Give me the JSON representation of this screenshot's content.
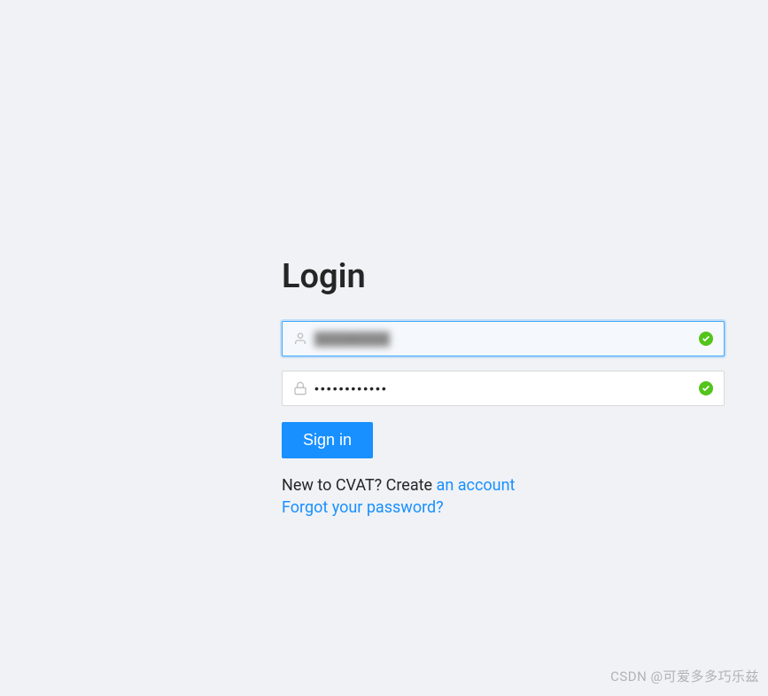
{
  "login": {
    "title": "Login",
    "username": {
      "value": "████████",
      "valid": true
    },
    "password": {
      "value": "••••••••••••",
      "valid": true
    },
    "signin_label": "Sign in",
    "register": {
      "prefix": "New to CVAT? Create ",
      "link": "an account"
    },
    "forgot_link": "Forgot your password?"
  },
  "watermark": "CSDN @可爱多多巧乐兹"
}
